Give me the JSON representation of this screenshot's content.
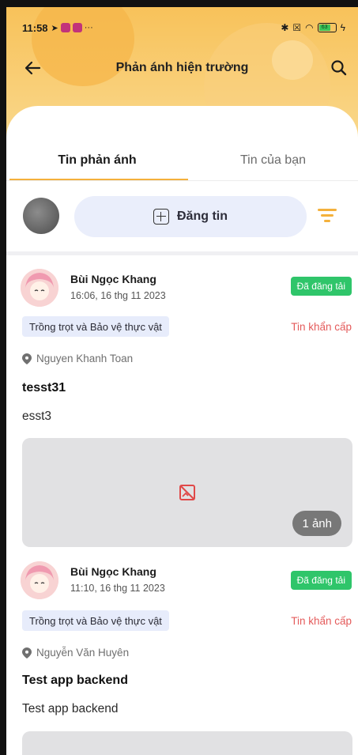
{
  "status_bar": {
    "time": "11:58",
    "more": "···",
    "battery": "63"
  },
  "header": {
    "title": "Phản ánh hiện trường"
  },
  "tabs": [
    {
      "label": "Tin phản ánh",
      "active": true
    },
    {
      "label": "Tin của bạn",
      "active": false
    }
  ],
  "composer": {
    "post_label": "Đăng tin"
  },
  "posts": [
    {
      "author": "Bùi Ngọc Khang",
      "time": "16:06, 16 thg 11 2023",
      "status": "Đã đăng tải",
      "category": "Trồng trọt và Bảo vệ thực vật",
      "urgency": "Tin khẩn cấp",
      "location": "Nguyen Khanh Toan",
      "title": "tesst31",
      "body": "esst3",
      "image_count": "1 ảnh"
    },
    {
      "author": "Bùi Ngọc Khang",
      "time": "11:10, 16 thg 11 2023",
      "status": "Đã đăng tải",
      "category": "Trồng trọt và Bảo vệ thực vật",
      "urgency": "Tin khẩn cấp",
      "location": "Nguyễn Văn Huyên",
      "title": "Test app backend",
      "body": "Test app backend"
    }
  ],
  "colors": {
    "header": "#f8c25a",
    "accent": "#f4b13c",
    "published": "#2fc56a",
    "urgent": "#e45b5b",
    "tag_bg": "#e7ecfb"
  }
}
